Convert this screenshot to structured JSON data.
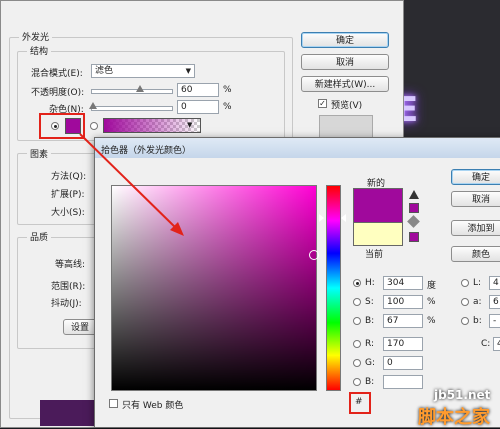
{
  "colors": {
    "new_color": "#a0099c",
    "current_color": "#ffffc0",
    "glow_swatch": "#a0099c",
    "annotation": "#e2231a",
    "gradient_end": "#ffffff"
  },
  "outer_glow": {
    "title": "外发光",
    "structure_title": "结构",
    "blend_mode_label": "混合模式(E):",
    "blend_mode_value": "滤色",
    "opacity_label": "不透明度(O):",
    "opacity_value": "60",
    "noise_label": "杂色(N):",
    "noise_value": "0",
    "percent": "%",
    "elements_title": "图素",
    "method_label": "方法(Q):",
    "spread_label": "扩展(P):",
    "size_label": "大小(S):",
    "quality_title": "品质",
    "contour_label": "等高线:",
    "range_label": "范围(R):",
    "jitter_label": "抖动(J):",
    "reset_label": "设置"
  },
  "side_buttons": {
    "ok": "确定",
    "cancel": "取消",
    "new_style": "新建样式(W)...",
    "preview_label": "预览(V)",
    "preview_checked": true
  },
  "picker": {
    "title": "拾色器（外发光颜色）",
    "new_label": "新的",
    "current_label": "当前",
    "ok": "确定",
    "cancel": "取消",
    "add_swatch": "添加到",
    "color_lib": "颜色",
    "web_only_label": "只有 Web 颜色",
    "hash": "#",
    "hsb": [
      {
        "label": "H:",
        "value": "304",
        "unit": "度",
        "selected": true
      },
      {
        "label": "S:",
        "value": "100",
        "unit": "%",
        "selected": false
      },
      {
        "label": "B:",
        "value": "67",
        "unit": "%",
        "selected": false
      }
    ],
    "rgb": [
      {
        "label": "R:",
        "value": "170",
        "selected": false
      },
      {
        "label": "G:",
        "value": "0",
        "selected": false
      },
      {
        "label": "B:",
        "value": "",
        "selected": false
      }
    ],
    "lab": [
      {
        "label": "L:",
        "value": "4"
      },
      {
        "label": "a:",
        "value": "6"
      },
      {
        "label": "b:",
        "value": "-"
      }
    ],
    "c_label": "C:",
    "c_value": "4"
  },
  "watermark": {
    "site": "jb51.net",
    "name": "脚本之家"
  }
}
